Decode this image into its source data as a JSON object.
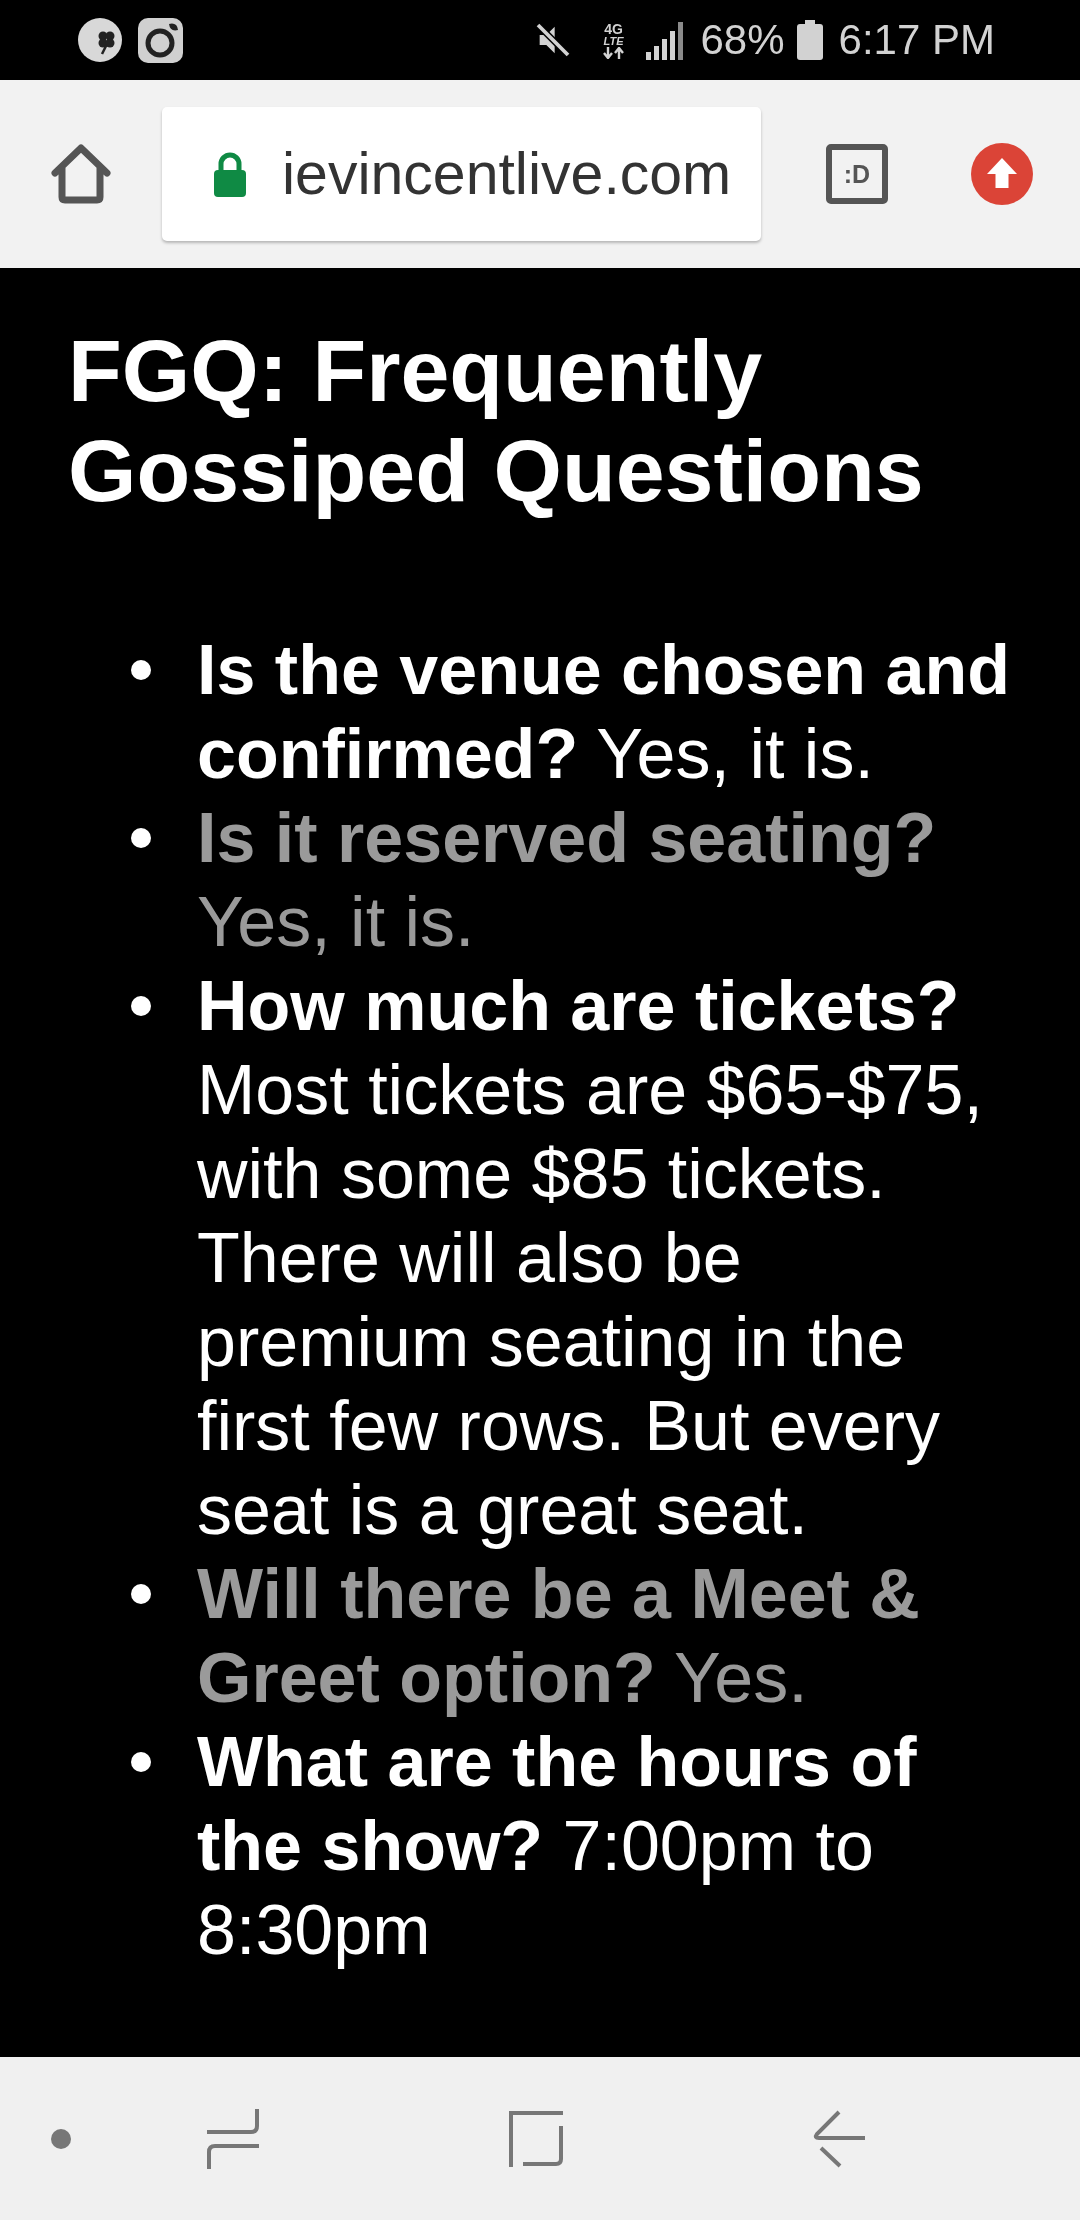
{
  "status_bar": {
    "network_type": [
      "4G",
      "LTE"
    ],
    "battery": "68%",
    "time": "6:17 PM"
  },
  "browser_toolbar": {
    "url": "ievincentlive.com",
    "tab_switcher": ":D"
  },
  "page": {
    "title": "FGQ: Frequently Gossiped Questions",
    "faq": [
      {
        "text": "**Is the venue chosen and confirmed?** Yes, it is.",
        "color": "#ffffff"
      },
      {
        "text": "**Is it reserved seating?** Yes, it is.",
        "color": "#9a9a9a"
      },
      {
        "text": "**How much are tickets?** Most tickets are $65-$75, with some $85 tickets. There will also be premium seating in the first few rows. But every seat is a great seat.",
        "color": "#ffffff"
      },
      {
        "text": "**Will there be a Meet & Greet option?** Yes.",
        "color": "#9a9a9a"
      },
      {
        "text": "**What are the hours of the show?** 7:00pm to 8:30pm",
        "color": "#ffffff"
      }
    ]
  }
}
